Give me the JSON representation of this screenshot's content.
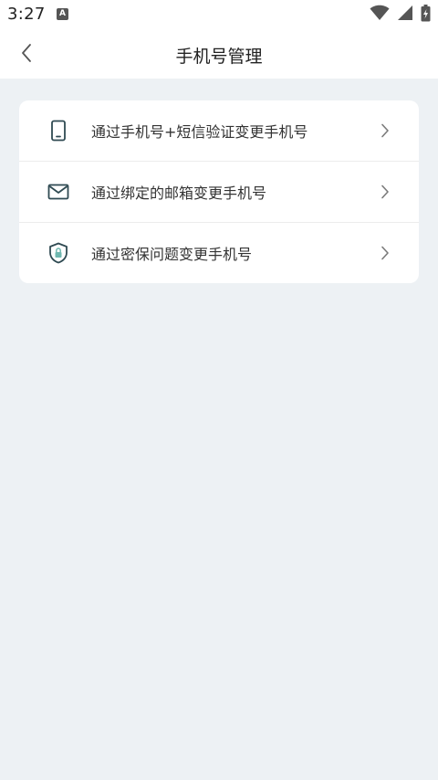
{
  "status_bar": {
    "time": "3:27",
    "notification_icon_letter": "A",
    "icons": [
      "wifi-icon",
      "signal-icon",
      "battery-icon"
    ]
  },
  "header": {
    "title": "手机号管理",
    "back_icon": "chevron-left-icon"
  },
  "options": [
    {
      "label": "通过手机号+短信验证变更手机号",
      "icon": "phone-icon"
    },
    {
      "label": "通过绑定的邮箱变更手机号",
      "icon": "mail-icon"
    },
    {
      "label": "通过密保问题变更手机号",
      "icon": "shield-lock-icon"
    }
  ],
  "colors": {
    "page_background": "#edf1f4",
    "card_background": "#ffffff",
    "icon_stroke": "#2f4a52",
    "shield_fill": "#6fb8b0",
    "text": "#333333",
    "chevron": "#7a7a7a"
  }
}
